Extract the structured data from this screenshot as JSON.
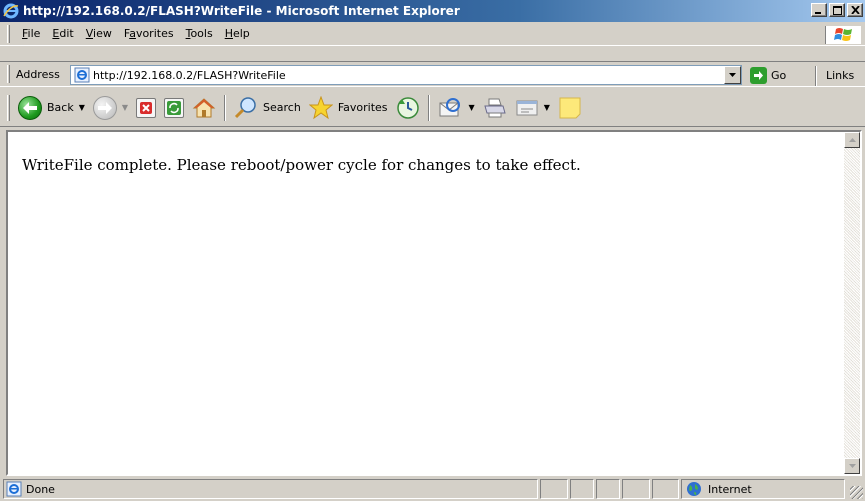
{
  "window": {
    "title": "http://192.168.0.2/FLASH?WriteFile - Microsoft Internet Explorer"
  },
  "menu": {
    "items": [
      {
        "label": "File",
        "key": "F"
      },
      {
        "label": "Edit",
        "key": "E"
      },
      {
        "label": "View",
        "key": "V"
      },
      {
        "label": "Favorites",
        "key": "a"
      },
      {
        "label": "Tools",
        "key": "T"
      },
      {
        "label": "Help",
        "key": "H"
      }
    ]
  },
  "address": {
    "label": "Address",
    "url": "http://192.168.0.2/FLASH?WriteFile",
    "go_label": "Go",
    "links_label": "Links"
  },
  "toolbar": {
    "back_label": "Back",
    "search_label": "Search",
    "favorites_label": "Favorites"
  },
  "page": {
    "message": "WriteFile complete. Please reboot/power cycle for changes to take effect."
  },
  "status": {
    "text": "Done",
    "zone": "Internet"
  },
  "colors": {
    "title_bar_start": "#0a246a",
    "title_bar_end": "#a6caf0",
    "chrome": "#d4d0c8",
    "go_button": "#2e9e2e"
  }
}
